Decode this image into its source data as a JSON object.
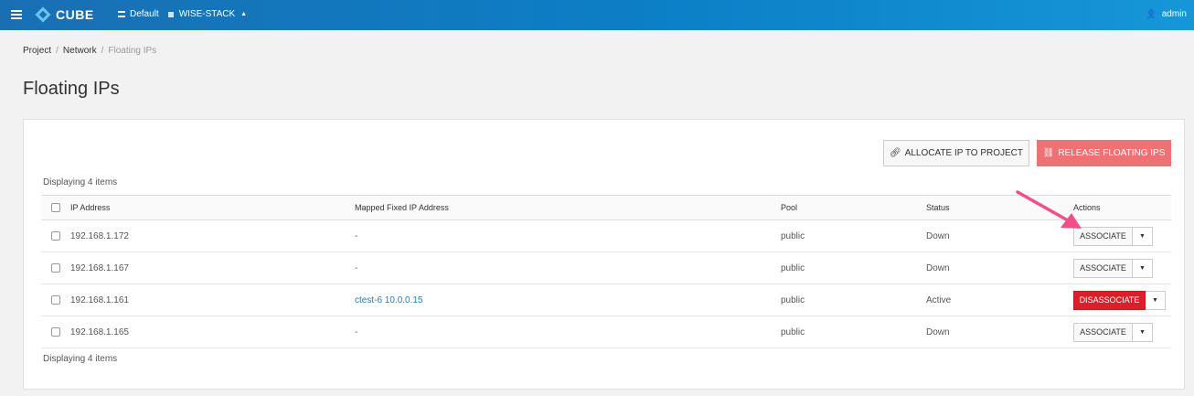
{
  "topbar": {
    "logo_text": "CUBE",
    "domain": "Default",
    "project": "WISE-STACK",
    "user": "admin"
  },
  "breadcrumb": {
    "items": [
      "Project",
      "Network",
      "Floating IPs"
    ]
  },
  "page": {
    "title": "Floating IPs"
  },
  "toolbar": {
    "allocate_label": "ALLOCATE IP TO PROJECT",
    "release_label": "RELEASE FLOATING IPS"
  },
  "table": {
    "count_label": "Displaying 4 items",
    "headers": {
      "ip": "IP Address",
      "mapped": "Mapped Fixed IP Address",
      "pool": "Pool",
      "status": "Status",
      "actions": "Actions"
    },
    "rows": [
      {
        "ip": "192.168.1.172",
        "mapped": "-",
        "pool": "public",
        "status": "Down",
        "action": "ASSOCIATE"
      },
      {
        "ip": "192.168.1.167",
        "mapped": "-",
        "pool": "public",
        "status": "Down",
        "action": "ASSOCIATE"
      },
      {
        "ip": "192.168.1.161",
        "mapped": "ctest-6 10.0.0.15",
        "pool": "public",
        "status": "Active",
        "action": "DISASSOCIATE"
      },
      {
        "ip": "192.168.1.165",
        "mapped": "-",
        "pool": "public",
        "status": "Down",
        "action": "ASSOCIATE"
      }
    ]
  },
  "colors": {
    "topbar": "#0c7fc7",
    "release_button": "#ee7174",
    "disassociate_button": "#d9202a",
    "link": "#2a7ab7",
    "annotation_arrow": "#f0508a"
  }
}
